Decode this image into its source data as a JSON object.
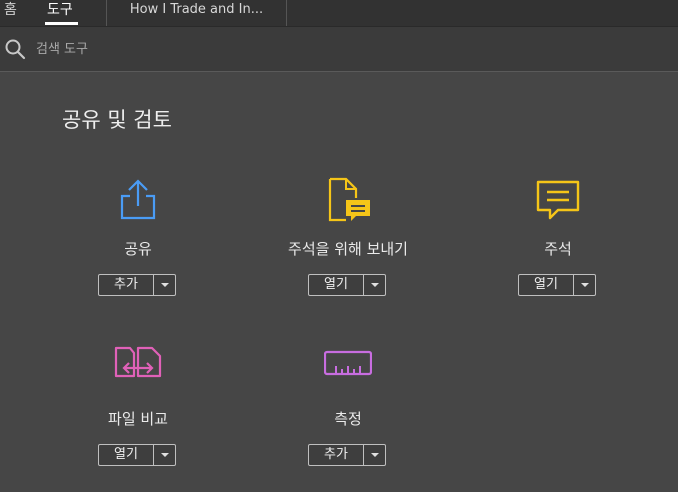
{
  "tabs": {
    "home": "홈",
    "tools": "도구",
    "document": "How I Trade and In..."
  },
  "search": {
    "placeholder": "검색 도구"
  },
  "section": {
    "title": "공유 및 검토"
  },
  "tools": [
    {
      "id": "share",
      "label": "공유",
      "button": "추가",
      "icon": "share-icon",
      "color": "#4a9cf5"
    },
    {
      "id": "send-for-comments",
      "label": "주석을 위해 보내기",
      "button": "열기",
      "icon": "send-for-comments-icon",
      "color": "#f5c518"
    },
    {
      "id": "comment",
      "label": "주석",
      "button": "열기",
      "icon": "comment-icon",
      "color": "#f5c518"
    },
    {
      "id": "compare",
      "label": "파일 비교",
      "button": "열기",
      "icon": "compare-files-icon",
      "color": "#e061b8"
    },
    {
      "id": "measure",
      "label": "측정",
      "button": "추가",
      "icon": "measure-icon",
      "color": "#c86de0"
    }
  ]
}
